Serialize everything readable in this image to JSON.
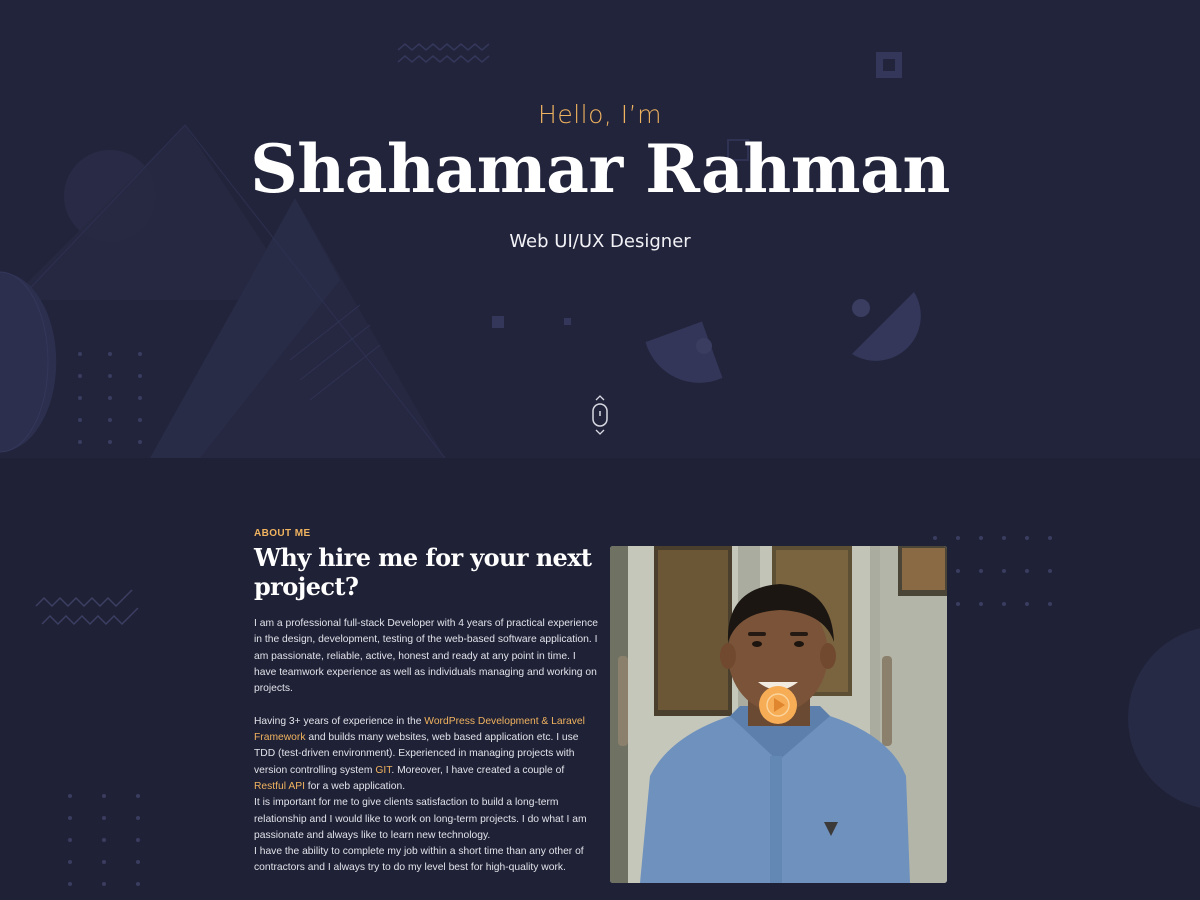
{
  "hero": {
    "greeting": "Hello, I’m",
    "name": "Shahamar Rahman",
    "role": "Web UI/UX Designer",
    "scroll_icon": "mouse-scroll-icon"
  },
  "about": {
    "eyebrow": "ABOUT ME",
    "title": "Why hire me for your next project?",
    "p1": "I am a professional full-stack Developer with 4 years of practical experience in the design, development, testing of the web-based software application. I am passionate, reliable, active, honest and ready at any point in time. I have teamwork experience as well as individuals managing and working on projects.",
    "p2_a": "Having 3+ years of experience in the ",
    "p2_hl1": "WordPress Development & Laravel Framework",
    "p2_b": " and builds many websites, web based application etc. I use TDD (test-driven environment). Experienced in managing projects with version controlling system ",
    "p2_hl2": "GIT",
    "p2_c": ". Moreover, I have created a couple of ",
    "p2_hl3": "Restful API",
    "p2_d": " for a web application.",
    "p3": "It is important for me to give clients satisfaction to build a long-term relationship and I would like to work on long-term projects. I do what I am passionate and always like to learn new technology.",
    "p4": "I have the ability to complete my job within a short time than any other of contractors and I always try to do my level best for high-quality work.",
    "photo_icon": "profile-photo",
    "play_icon": "play-icon"
  },
  "colors": {
    "accent": "#f0b35f",
    "background": "#22243b"
  }
}
